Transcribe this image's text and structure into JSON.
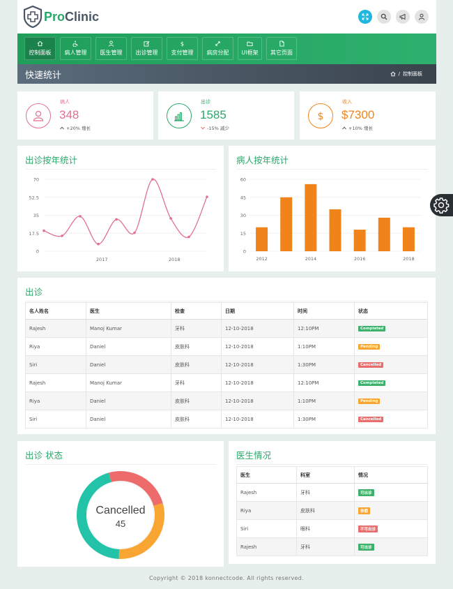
{
  "brand": {
    "part1": "Pro",
    "part2": "Clinic"
  },
  "colors": {
    "green": "#2aa86a",
    "pink": "#e0708e",
    "orange": "#f0841a",
    "completed": "#3eb06b",
    "pending": "#f8a531",
    "cancelled": "#e86d6d",
    "teal": "#22c3a8"
  },
  "top_icons": [
    "fullscreen-icon",
    "search-icon",
    "megaphone-icon",
    "user-icon"
  ],
  "nav": [
    {
      "label": "控制面板",
      "icon": "home-icon"
    },
    {
      "label": "病人管理",
      "icon": "wheelchair-icon"
    },
    {
      "label": "医生管理",
      "icon": "doctor-icon"
    },
    {
      "label": "出诊管理",
      "icon": "edit-icon"
    },
    {
      "label": "支付管理",
      "icon": "dollar-icon"
    },
    {
      "label": "病房分配",
      "icon": "expand-icon"
    },
    {
      "label": "UI框架",
      "icon": "folder-icon"
    },
    {
      "label": "其它页面",
      "icon": "file-icon"
    }
  ],
  "page": {
    "title": "快速统计",
    "breadcrumb": "控制面板"
  },
  "stats": [
    {
      "label": "病人",
      "value": "348",
      "change": "+20% 增长",
      "direction": "up"
    },
    {
      "label": "出诊",
      "value": "1585",
      "change": "-15% 减少",
      "direction": "down"
    },
    {
      "label": "收入",
      "value": "$7300",
      "change": "+10% 增长",
      "direction": "up"
    }
  ],
  "chart_data": [
    {
      "type": "line",
      "title": "出诊按年统计",
      "ylim": [
        0,
        70
      ],
      "yticks": [
        "0",
        "17.5",
        "35",
        "52.5",
        "70"
      ],
      "xticks": [
        {
          "label": "2017",
          "x": 2017
        },
        {
          "label": "2018",
          "x": 2018
        }
      ],
      "x": [
        2016.2,
        2016.45,
        2016.7,
        2016.95,
        2017.2,
        2017.45,
        2017.7,
        2017.95,
        2018.2,
        2018.45
      ],
      "values": [
        20,
        15,
        34,
        7,
        31,
        18,
        70,
        32,
        14,
        53
      ],
      "xlim": [
        2016.2,
        2018.45
      ]
    },
    {
      "type": "bar",
      "title": "病人按年统计",
      "ylim": [
        0,
        60
      ],
      "yticks": [
        "0",
        "15",
        "30",
        "45",
        "60"
      ],
      "xticks": [
        "2012",
        "2014",
        "2016",
        "2018"
      ],
      "categories": [
        "2012",
        "2013",
        "2014",
        "2015",
        "2016",
        "2017",
        "2018"
      ],
      "values": [
        20,
        45,
        56,
        35,
        18,
        28,
        20
      ]
    },
    {
      "type": "pie",
      "title": "出诊 状态",
      "center_label": "Cancelled",
      "center_value": "45",
      "slices": [
        {
          "label": "Completed",
          "value": 45,
          "color": "#22c3a8"
        },
        {
          "label": "Pending",
          "value": 30,
          "color": "#f8a531"
        },
        {
          "label": "Cancelled",
          "value": 25,
          "color": "#ee6b6b"
        }
      ]
    }
  ],
  "appointments": {
    "title": "出诊",
    "headers": [
      "名人姓名",
      "医生",
      "检查",
      "日期",
      "时间",
      "状态"
    ],
    "rows": [
      [
        "Rajesh",
        "Manoj Kumar",
        "牙科",
        "12-10-2018",
        "12:10PM",
        "Completed"
      ],
      [
        "Riya",
        "Daniel",
        "皮肤科",
        "12-10-2018",
        "1:10PM",
        "Pending"
      ],
      [
        "Siri",
        "Daniel",
        "皮肤科",
        "12-10-2018",
        "1:30PM",
        "Cancelled"
      ],
      [
        "Rajesh",
        "Manoj Kumar",
        "牙科",
        "12-10-2018",
        "12:10PM",
        "Completed"
      ],
      [
        "Riya",
        "Daniel",
        "皮肤科",
        "12-10-2018",
        "1:10PM",
        "Pending"
      ],
      [
        "Siri",
        "Daniel",
        "皮肤科",
        "12-10-2018",
        "1:30PM",
        "Cancelled"
      ]
    ]
  },
  "doctors": {
    "title": "医生情况",
    "headers": [
      "医生",
      "科室",
      "情况"
    ],
    "rows": [
      [
        "Rajesh",
        "牙科",
        "可出诊",
        "green"
      ],
      [
        "Riya",
        "皮肤科",
        "休假",
        "orange"
      ],
      [
        "Siri",
        "眼科",
        "不可出诊",
        "red"
      ],
      [
        "Rajesh",
        "牙科",
        "可出诊",
        "green"
      ]
    ]
  },
  "footer": "Copyright © 2018 konnectcode. All rights reserved."
}
